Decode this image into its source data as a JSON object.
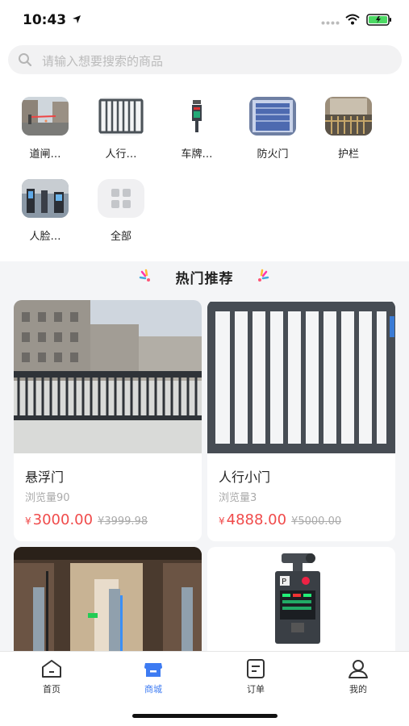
{
  "status_bar": {
    "time": "10:43"
  },
  "search": {
    "placeholder": "请输入想要搜索的商品"
  },
  "categories": [
    {
      "label": "道闸…",
      "icon": "barrier-gate-image"
    },
    {
      "label": "人行…",
      "icon": "pedestrian-gate-image"
    },
    {
      "label": "车牌…",
      "icon": "license-plate-camera-image"
    },
    {
      "label": "防火门",
      "icon": "fire-door-image"
    },
    {
      "label": "护栏",
      "icon": "guardrail-image"
    },
    {
      "label": "人脸…",
      "icon": "face-recognition-image"
    },
    {
      "label": "全部",
      "icon": "grid-icon"
    }
  ],
  "hot_section": {
    "title": "热门推荐"
  },
  "products": [
    {
      "name": "悬浮门",
      "views": "浏览量90",
      "currency": "¥",
      "price": "3000.00",
      "original_price": "¥3999.98"
    },
    {
      "name": "人行小门",
      "views": "浏览量3",
      "currency": "¥",
      "price": "4888.00",
      "original_price": "¥5000.00"
    },
    {
      "name": "",
      "views": "",
      "currency": "",
      "price": "",
      "original_price": ""
    },
    {
      "name": "",
      "views": "",
      "currency": "",
      "price": "",
      "original_price": ""
    }
  ],
  "tabbar": [
    {
      "label": "首页",
      "icon": "home-icon",
      "active": false
    },
    {
      "label": "商城",
      "icon": "store-icon",
      "active": true
    },
    {
      "label": "订单",
      "icon": "order-icon",
      "active": false
    },
    {
      "label": "我的",
      "icon": "profile-icon",
      "active": false
    }
  ],
  "colors": {
    "accent": "#3d7bf2",
    "price": "#f04b4b",
    "background": "#f4f5f7"
  }
}
